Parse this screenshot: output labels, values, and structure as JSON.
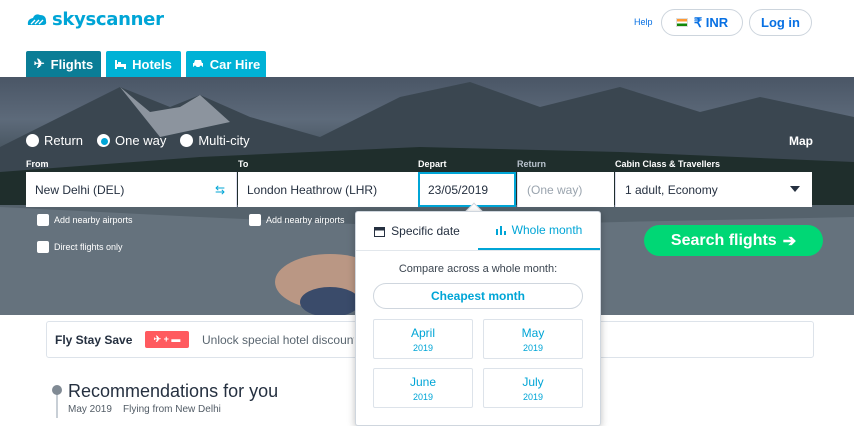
{
  "header": {
    "logo_text": "skyscanner",
    "help": "Help",
    "currency": "₹ INR",
    "login": "Log in"
  },
  "tabs": [
    {
      "label": "Flights",
      "icon": "plane-icon"
    },
    {
      "label": "Hotels",
      "icon": "bed-icon"
    },
    {
      "label": "Car Hire",
      "icon": "car-icon"
    }
  ],
  "trip_type": {
    "options": [
      "Return",
      "One way",
      "Multi-city"
    ],
    "selected": "One way"
  },
  "map": "Map",
  "fields": {
    "from_label": "From",
    "from_value": "New Delhi (DEL)",
    "to_label": "To",
    "to_value": "London Heathrow (LHR)",
    "depart_label": "Depart",
    "depart_value": "23/05/2019",
    "return_label": "Return",
    "return_value": "(One way)",
    "cabin_label": "Cabin Class & Travellers",
    "cabin_value": "1 adult, Economy"
  },
  "checkboxes": {
    "nearby_from": "Add nearby airports",
    "nearby_to": "Add nearby airports",
    "direct": "Direct flights only"
  },
  "search_button": "Search flights",
  "promo": {
    "title": "Fly Stay Save",
    "text": "Unlock special hotel discounts"
  },
  "recommendations": {
    "title": "Recommendations for you",
    "month": "May 2019",
    "from": "Flying from New Delhi"
  },
  "date_popover": {
    "tab_specific": "Specific date",
    "tab_whole": "Whole month",
    "compare": "Compare across a whole month:",
    "cheapest": "Cheapest month",
    "months": [
      {
        "month": "April",
        "year": "2019"
      },
      {
        "month": "May",
        "year": "2019"
      },
      {
        "month": "June",
        "year": "2019"
      },
      {
        "month": "July",
        "year": "2019"
      }
    ]
  },
  "colors": {
    "brand": "#00a5d6",
    "tab": "#00b2d6",
    "tab_active": "#0a7d96",
    "search": "#00d775",
    "promo_badge": "#ff5a5f"
  }
}
